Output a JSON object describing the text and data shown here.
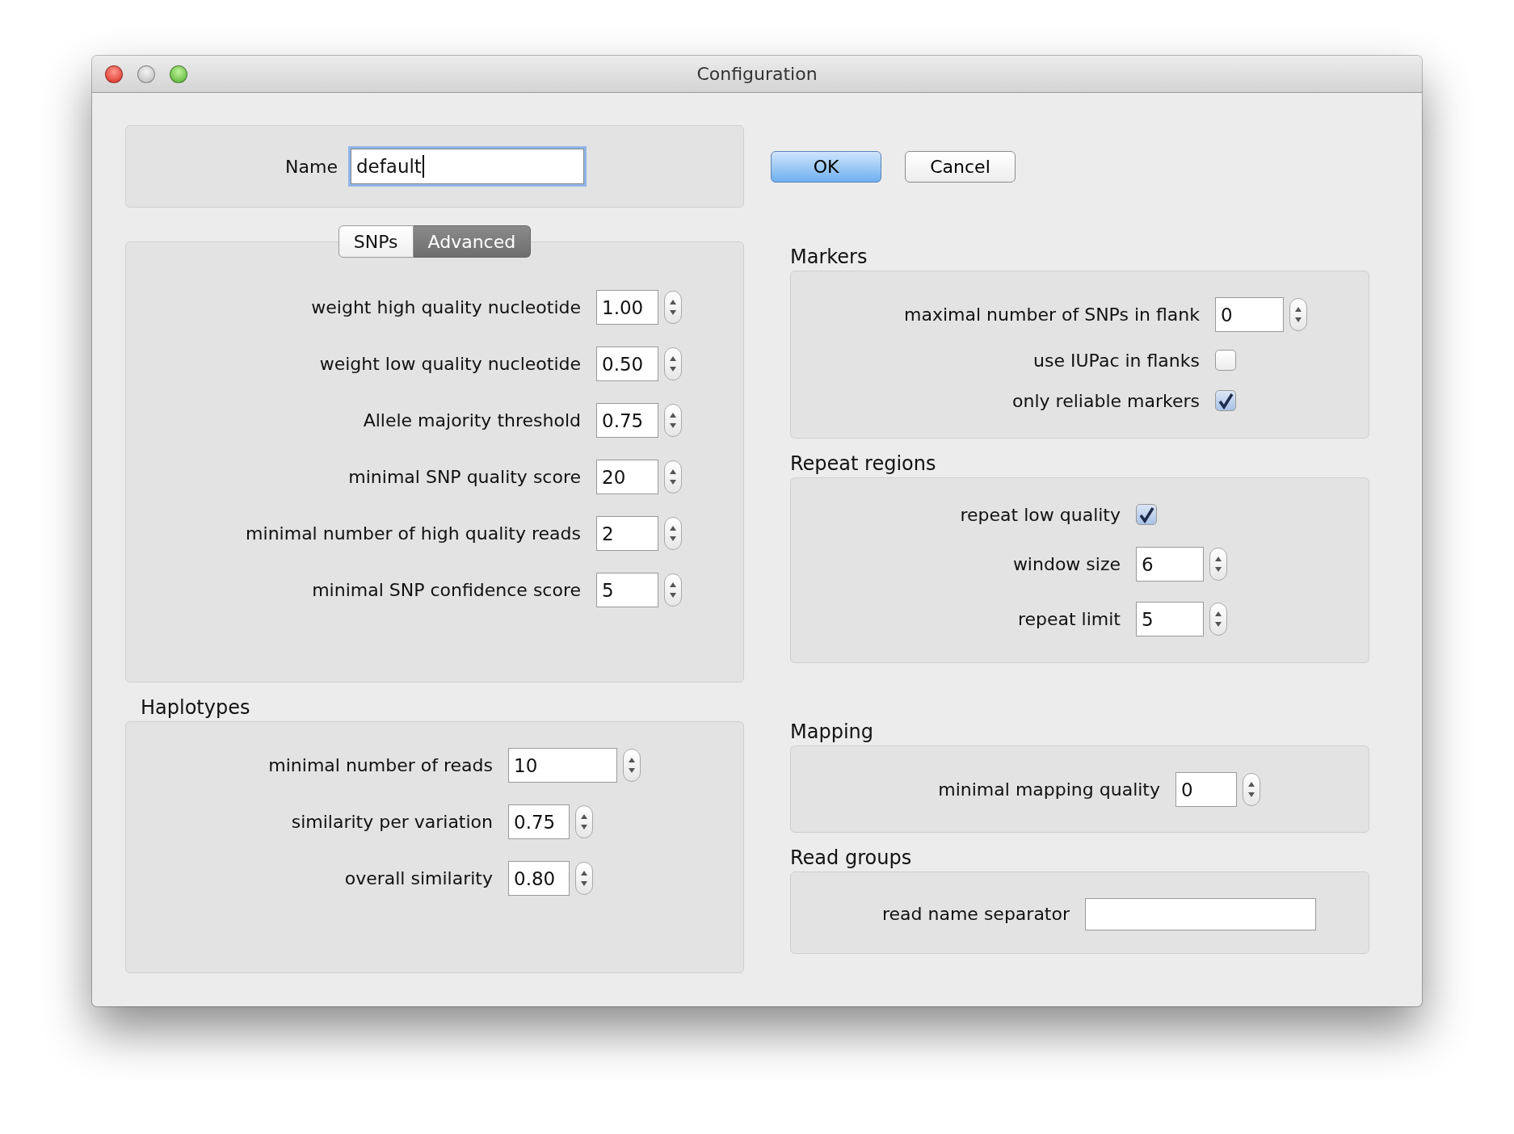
{
  "window": {
    "title": "Configuration"
  },
  "name_field": {
    "label": "Name",
    "value": "default"
  },
  "buttons": [
    {
      "label": "OK",
      "kind": "default"
    },
    {
      "label": "Cancel",
      "kind": "normal"
    }
  ],
  "tabs": [
    {
      "label": "SNPs",
      "selected": false
    },
    {
      "label": "Advanced",
      "selected": true
    }
  ],
  "advanced_settings": [
    {
      "kind": "spinner",
      "label": "weight high quality nucleotide",
      "value": "1.00"
    },
    {
      "kind": "spinner",
      "label": "weight low quality nucleotide",
      "value": "0.50"
    },
    {
      "kind": "spinner",
      "label": "Allele majority threshold",
      "value": "0.75"
    },
    {
      "kind": "spinner",
      "label": "minimal SNP quality score",
      "value": "20"
    },
    {
      "kind": "spinner",
      "label": "minimal number of high quality reads",
      "value": "2"
    },
    {
      "kind": "spinner",
      "label": "minimal SNP confidence score",
      "value": "5"
    }
  ],
  "haplotypes": {
    "title": "Haplotypes",
    "fields": [
      {
        "kind": "spinner",
        "label": "minimal number of reads",
        "value": "10"
      },
      {
        "kind": "spinner",
        "label": "similarity per variation",
        "value": "0.75"
      },
      {
        "kind": "spinner",
        "label": "overall similarity",
        "value": "0.80"
      }
    ]
  },
  "markers": {
    "title": "Markers",
    "fields": [
      {
        "kind": "spinner",
        "label": "maximal number of SNPs in flank",
        "value": "0"
      },
      {
        "kind": "checkbox",
        "label": "use IUPac in flanks",
        "checked": false
      },
      {
        "kind": "checkbox",
        "label": "only reliable markers",
        "checked": true
      }
    ]
  },
  "repeat_regions": {
    "title": "Repeat regions",
    "fields": [
      {
        "kind": "checkbox",
        "label": "repeat low quality",
        "checked": true
      },
      {
        "kind": "spinner",
        "label": "window size",
        "value": "6"
      },
      {
        "kind": "spinner",
        "label": "repeat limit",
        "value": "5"
      }
    ]
  },
  "mapping": {
    "title": "Mapping",
    "fields": [
      {
        "kind": "spinner",
        "label": "minimal mapping quality",
        "value": "0"
      }
    ]
  },
  "read_groups": {
    "title": "Read groups",
    "fields": [
      {
        "kind": "text",
        "label": "read name separator"
      }
    ]
  }
}
